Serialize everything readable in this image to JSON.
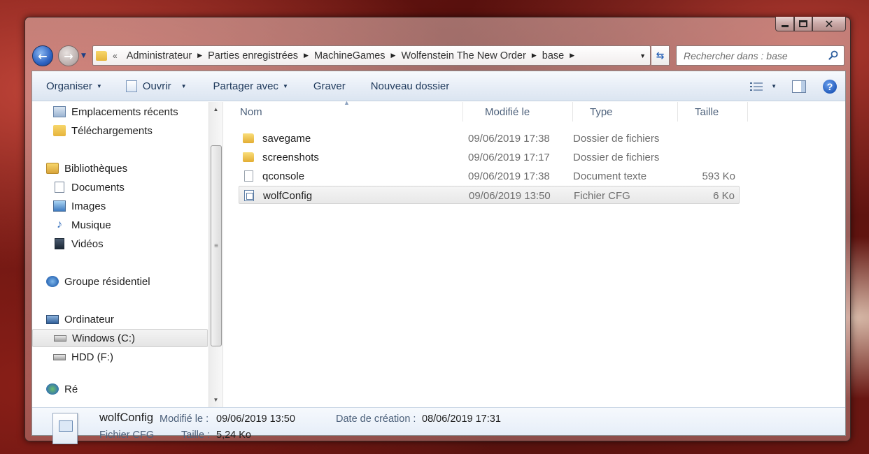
{
  "window": {
    "caption_close_glyph": "✕"
  },
  "nav": {
    "back_glyph": "←",
    "forward_glyph": "→"
  },
  "address": {
    "overflow_glyph": "«",
    "crumbs": [
      "Administrateur",
      "Parties enregistrées",
      "MachineGames",
      "Wolfenstein The New Order",
      "base"
    ]
  },
  "search": {
    "placeholder": "Rechercher dans : base"
  },
  "toolbar": {
    "organize": "Organiser",
    "open": "Ouvrir",
    "share": "Partager avec",
    "burn": "Graver",
    "new_folder": "Nouveau dossier",
    "help_glyph": "?"
  },
  "sidebar": {
    "items": [
      {
        "label": "Emplacements récents",
        "icon": "recent-places-icon"
      },
      {
        "label": "Téléchargements",
        "icon": "downloads-folder-icon"
      },
      {
        "label": "Bibliothèques",
        "icon": "libraries-icon"
      },
      {
        "label": "Documents",
        "icon": "documents-icon"
      },
      {
        "label": "Images",
        "icon": "pictures-icon"
      },
      {
        "label": "Musique",
        "icon": "music-icon"
      },
      {
        "label": "Vidéos",
        "icon": "videos-icon"
      },
      {
        "label": "Groupe résidentiel",
        "icon": "homegroup-icon"
      },
      {
        "label": "Ordinateur",
        "icon": "computer-icon"
      },
      {
        "label": "Windows (C:)",
        "icon": "system-drive-icon",
        "selected": true
      },
      {
        "label": "HDD (F:)",
        "icon": "hard-drive-icon"
      },
      {
        "label": "Ré",
        "icon": "network-icon"
      }
    ]
  },
  "filelist": {
    "columns": [
      "Nom",
      "Modifié le",
      "Type",
      "Taille"
    ],
    "rows": [
      {
        "name": "savegame",
        "modified": "09/06/2019 17:38",
        "type": "Dossier de fichiers",
        "size": "",
        "icon": "folder-icon"
      },
      {
        "name": "screenshots",
        "modified": "09/06/2019 17:17",
        "type": "Dossier de fichiers",
        "size": "",
        "icon": "folder-icon"
      },
      {
        "name": "qconsole",
        "modified": "09/06/2019 17:38",
        "type": "Document texte",
        "size": "593 Ko",
        "icon": "text-file-icon"
      },
      {
        "name": "wolfConfig",
        "modified": "09/06/2019 13:50",
        "type": "Fichier CFG",
        "size": "6 Ko",
        "icon": "cfg-file-icon",
        "selected": true
      }
    ]
  },
  "details": {
    "name": "wolfConfig",
    "modified_label": "Modifié le :",
    "modified_value": "09/06/2019 13:50",
    "created_label": "Date de création :",
    "created_value": "08/06/2019 17:31",
    "type": "Fichier CFG",
    "size_label": "Taille :",
    "size_value": "5,24 Ko"
  },
  "colors": {
    "command_text": "#1e395b",
    "header_text": "#4c607a",
    "secondary_text": "#6d6d6d",
    "selection_border": "#d4d4d4"
  }
}
